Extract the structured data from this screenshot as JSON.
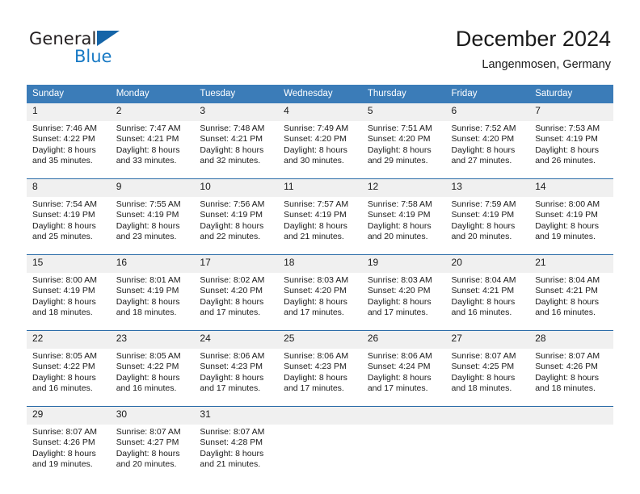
{
  "logo": {
    "word1": "General",
    "word2": "Blue",
    "triangle_color": "#1565a8",
    "blue_text_color": "#1779c4"
  },
  "header": {
    "title": "December 2024",
    "subtitle": "Langenmosen, Germany"
  },
  "colors": {
    "header_blue": "#3b7cb8",
    "separator_blue": "#2b6ca8",
    "daynum_band": "#f0f0f0",
    "text": "#1a1a1a"
  },
  "weekday_headers": [
    "Sunday",
    "Monday",
    "Tuesday",
    "Wednesday",
    "Thursday",
    "Friday",
    "Saturday"
  ],
  "weeks": [
    {
      "days": [
        {
          "num": "1",
          "sunrise": "Sunrise: 7:46 AM",
          "sunset": "Sunset: 4:22 PM",
          "daylight1": "Daylight: 8 hours",
          "daylight2": "and 35 minutes."
        },
        {
          "num": "2",
          "sunrise": "Sunrise: 7:47 AM",
          "sunset": "Sunset: 4:21 PM",
          "daylight1": "Daylight: 8 hours",
          "daylight2": "and 33 minutes."
        },
        {
          "num": "3",
          "sunrise": "Sunrise: 7:48 AM",
          "sunset": "Sunset: 4:21 PM",
          "daylight1": "Daylight: 8 hours",
          "daylight2": "and 32 minutes."
        },
        {
          "num": "4",
          "sunrise": "Sunrise: 7:49 AM",
          "sunset": "Sunset: 4:20 PM",
          "daylight1": "Daylight: 8 hours",
          "daylight2": "and 30 minutes."
        },
        {
          "num": "5",
          "sunrise": "Sunrise: 7:51 AM",
          "sunset": "Sunset: 4:20 PM",
          "daylight1": "Daylight: 8 hours",
          "daylight2": "and 29 minutes."
        },
        {
          "num": "6",
          "sunrise": "Sunrise: 7:52 AM",
          "sunset": "Sunset: 4:20 PM",
          "daylight1": "Daylight: 8 hours",
          "daylight2": "and 27 minutes."
        },
        {
          "num": "7",
          "sunrise": "Sunrise: 7:53 AM",
          "sunset": "Sunset: 4:19 PM",
          "daylight1": "Daylight: 8 hours",
          "daylight2": "and 26 minutes."
        }
      ]
    },
    {
      "days": [
        {
          "num": "8",
          "sunrise": "Sunrise: 7:54 AM",
          "sunset": "Sunset: 4:19 PM",
          "daylight1": "Daylight: 8 hours",
          "daylight2": "and 25 minutes."
        },
        {
          "num": "9",
          "sunrise": "Sunrise: 7:55 AM",
          "sunset": "Sunset: 4:19 PM",
          "daylight1": "Daylight: 8 hours",
          "daylight2": "and 23 minutes."
        },
        {
          "num": "10",
          "sunrise": "Sunrise: 7:56 AM",
          "sunset": "Sunset: 4:19 PM",
          "daylight1": "Daylight: 8 hours",
          "daylight2": "and 22 minutes."
        },
        {
          "num": "11",
          "sunrise": "Sunrise: 7:57 AM",
          "sunset": "Sunset: 4:19 PM",
          "daylight1": "Daylight: 8 hours",
          "daylight2": "and 21 minutes."
        },
        {
          "num": "12",
          "sunrise": "Sunrise: 7:58 AM",
          "sunset": "Sunset: 4:19 PM",
          "daylight1": "Daylight: 8 hours",
          "daylight2": "and 20 minutes."
        },
        {
          "num": "13",
          "sunrise": "Sunrise: 7:59 AM",
          "sunset": "Sunset: 4:19 PM",
          "daylight1": "Daylight: 8 hours",
          "daylight2": "and 20 minutes."
        },
        {
          "num": "14",
          "sunrise": "Sunrise: 8:00 AM",
          "sunset": "Sunset: 4:19 PM",
          "daylight1": "Daylight: 8 hours",
          "daylight2": "and 19 minutes."
        }
      ]
    },
    {
      "days": [
        {
          "num": "15",
          "sunrise": "Sunrise: 8:00 AM",
          "sunset": "Sunset: 4:19 PM",
          "daylight1": "Daylight: 8 hours",
          "daylight2": "and 18 minutes."
        },
        {
          "num": "16",
          "sunrise": "Sunrise: 8:01 AM",
          "sunset": "Sunset: 4:19 PM",
          "daylight1": "Daylight: 8 hours",
          "daylight2": "and 18 minutes."
        },
        {
          "num": "17",
          "sunrise": "Sunrise: 8:02 AM",
          "sunset": "Sunset: 4:20 PM",
          "daylight1": "Daylight: 8 hours",
          "daylight2": "and 17 minutes."
        },
        {
          "num": "18",
          "sunrise": "Sunrise: 8:03 AM",
          "sunset": "Sunset: 4:20 PM",
          "daylight1": "Daylight: 8 hours",
          "daylight2": "and 17 minutes."
        },
        {
          "num": "19",
          "sunrise": "Sunrise: 8:03 AM",
          "sunset": "Sunset: 4:20 PM",
          "daylight1": "Daylight: 8 hours",
          "daylight2": "and 17 minutes."
        },
        {
          "num": "20",
          "sunrise": "Sunrise: 8:04 AM",
          "sunset": "Sunset: 4:21 PM",
          "daylight1": "Daylight: 8 hours",
          "daylight2": "and 16 minutes."
        },
        {
          "num": "21",
          "sunrise": "Sunrise: 8:04 AM",
          "sunset": "Sunset: 4:21 PM",
          "daylight1": "Daylight: 8 hours",
          "daylight2": "and 16 minutes."
        }
      ]
    },
    {
      "days": [
        {
          "num": "22",
          "sunrise": "Sunrise: 8:05 AM",
          "sunset": "Sunset: 4:22 PM",
          "daylight1": "Daylight: 8 hours",
          "daylight2": "and 16 minutes."
        },
        {
          "num": "23",
          "sunrise": "Sunrise: 8:05 AM",
          "sunset": "Sunset: 4:22 PM",
          "daylight1": "Daylight: 8 hours",
          "daylight2": "and 16 minutes."
        },
        {
          "num": "24",
          "sunrise": "Sunrise: 8:06 AM",
          "sunset": "Sunset: 4:23 PM",
          "daylight1": "Daylight: 8 hours",
          "daylight2": "and 17 minutes."
        },
        {
          "num": "25",
          "sunrise": "Sunrise: 8:06 AM",
          "sunset": "Sunset: 4:23 PM",
          "daylight1": "Daylight: 8 hours",
          "daylight2": "and 17 minutes."
        },
        {
          "num": "26",
          "sunrise": "Sunrise: 8:06 AM",
          "sunset": "Sunset: 4:24 PM",
          "daylight1": "Daylight: 8 hours",
          "daylight2": "and 17 minutes."
        },
        {
          "num": "27",
          "sunrise": "Sunrise: 8:07 AM",
          "sunset": "Sunset: 4:25 PM",
          "daylight1": "Daylight: 8 hours",
          "daylight2": "and 18 minutes."
        },
        {
          "num": "28",
          "sunrise": "Sunrise: 8:07 AM",
          "sunset": "Sunset: 4:26 PM",
          "daylight1": "Daylight: 8 hours",
          "daylight2": "and 18 minutes."
        }
      ]
    },
    {
      "days": [
        {
          "num": "29",
          "sunrise": "Sunrise: 8:07 AM",
          "sunset": "Sunset: 4:26 PM",
          "daylight1": "Daylight: 8 hours",
          "daylight2": "and 19 minutes."
        },
        {
          "num": "30",
          "sunrise": "Sunrise: 8:07 AM",
          "sunset": "Sunset: 4:27 PM",
          "daylight1": "Daylight: 8 hours",
          "daylight2": "and 20 minutes."
        },
        {
          "num": "31",
          "sunrise": "Sunrise: 8:07 AM",
          "sunset": "Sunset: 4:28 PM",
          "daylight1": "Daylight: 8 hours",
          "daylight2": "and 21 minutes."
        },
        {
          "num": "",
          "sunrise": "",
          "sunset": "",
          "daylight1": "",
          "daylight2": ""
        },
        {
          "num": "",
          "sunrise": "",
          "sunset": "",
          "daylight1": "",
          "daylight2": ""
        },
        {
          "num": "",
          "sunrise": "",
          "sunset": "",
          "daylight1": "",
          "daylight2": ""
        },
        {
          "num": "",
          "sunrise": "",
          "sunset": "",
          "daylight1": "",
          "daylight2": ""
        }
      ]
    }
  ]
}
